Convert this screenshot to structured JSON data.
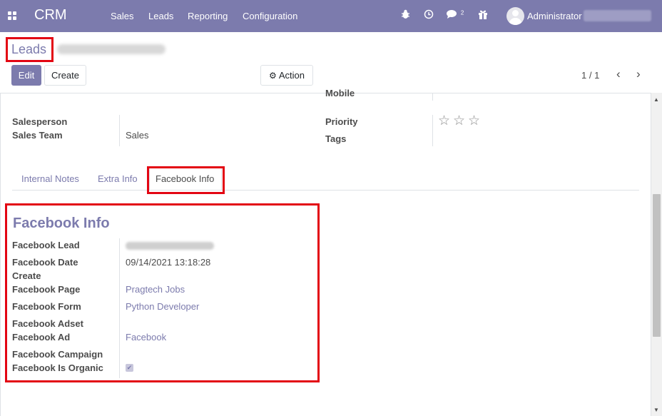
{
  "navbar": {
    "app_name": "CRM",
    "menu": [
      "Sales",
      "Leads",
      "Reporting",
      "Configuration"
    ],
    "chat_count": "2",
    "user": "Administrator",
    "icons": [
      "apps-grid-icon",
      "bug-icon",
      "clock-icon",
      "chat-icon",
      "gift-icon",
      "user-avatar"
    ]
  },
  "breadcrumb": {
    "root": "Leads"
  },
  "buttons": {
    "edit": "Edit",
    "create": "Create",
    "action": "Action",
    "action_icon": "⚙"
  },
  "pager": {
    "value": "1 / 1",
    "prev": "‹",
    "next": "›"
  },
  "form": {
    "mobile_label": "Mobile",
    "salesperson_label": "Salesperson",
    "sales_team_label": "Sales Team",
    "sales_team_value": "Sales",
    "priority_label": "Priority",
    "priority_stars": "0 of 3",
    "star": "☆",
    "tags_label": "Tags"
  },
  "tabs": [
    "Internal Notes",
    "Extra Info",
    "Facebook Info"
  ],
  "active_tab": "Facebook Info",
  "facebook": {
    "title": "Facebook Info",
    "lead_label": "Facebook Lead",
    "date_label_1": "Facebook Date",
    "date_label_2": "Create",
    "date_value": "09/14/2021 13:18:28",
    "page_label": "Facebook Page",
    "page_value": "Pragtech Jobs",
    "form_label": "Facebook Form",
    "form_value": "Python Developer",
    "adset_label": "Facebook Adset",
    "ad_label": "Facebook Ad",
    "ad_value": "Facebook",
    "campaign_label": "Facebook Campaign",
    "organic_label": "Facebook Is Organic",
    "organic_checked": true,
    "check_glyph": "✔"
  },
  "colors": {
    "brand": "#7c7bad",
    "highlight": "#e30613"
  }
}
